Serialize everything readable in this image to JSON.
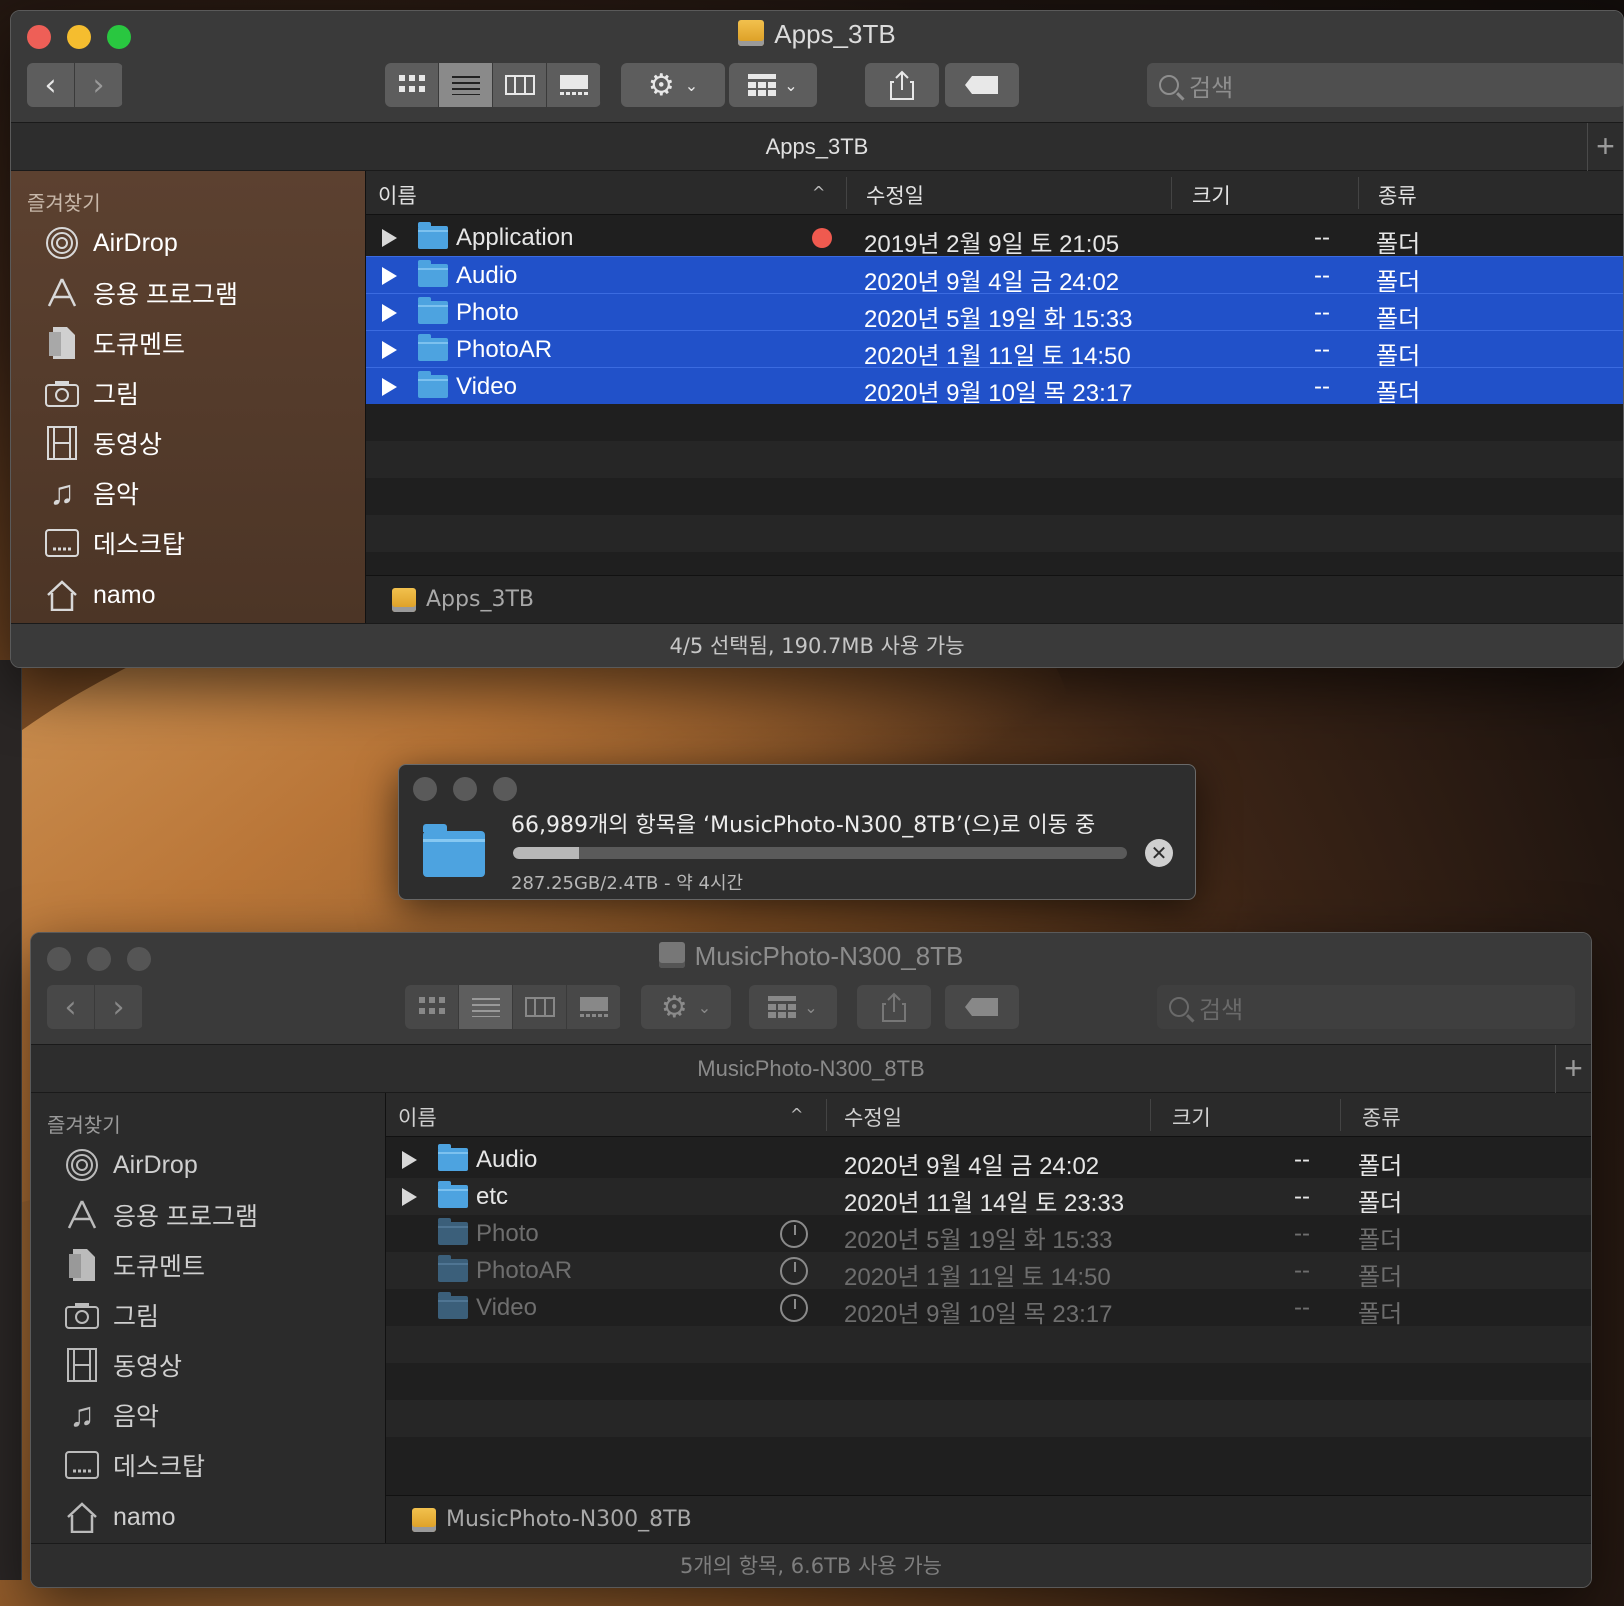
{
  "window1": {
    "title": "Apps_3TB",
    "path_title": "Apps_3TB",
    "search_placeholder": "검색",
    "sidebar_header": "즐겨찾기",
    "sidebar": [
      "AirDrop",
      "응용 프로그램",
      "도큐멘트",
      "그림",
      "동영상",
      "음악",
      "데스크탑",
      "namo"
    ],
    "columns": {
      "name": "이름",
      "date": "수정일",
      "size": "크기",
      "kind": "종류"
    },
    "rows": [
      {
        "name": "Application",
        "date": "2019년 2월 9일 토 21:05",
        "size": "--",
        "kind": "폴더",
        "tag_color": "#ef5a4f"
      },
      {
        "name": "Audio",
        "date": "2020년 9월 4일 금 24:02",
        "size": "--",
        "kind": "폴더",
        "selected": true
      },
      {
        "name": "Photo",
        "date": "2020년 5월 19일 화 15:33",
        "size": "--",
        "kind": "폴더",
        "selected": true
      },
      {
        "name": "PhotoAR",
        "date": "2020년 1월 11일 토 14:50",
        "size": "--",
        "kind": "폴더",
        "selected": true
      },
      {
        "name": "Video",
        "date": "2020년 9월 10일 목 23:17",
        "size": "--",
        "kind": "폴더",
        "selected": true
      }
    ],
    "pathbar": "Apps_3TB",
    "status": "4/5 선택됨, 190.7MB 사용 가능"
  },
  "progress": {
    "message": "66,989개의 항목을 ‘MusicPhoto-N300_8TB’(으)로 이동 중",
    "detail": "287.25GB/2.4TB - 약 4시간",
    "fraction": 0.107
  },
  "window2": {
    "title": "MusicPhoto-N300_8TB",
    "path_title": "MusicPhoto-N300_8TB",
    "search_placeholder": "검색",
    "sidebar_header": "즐겨찾기",
    "sidebar": [
      "AirDrop",
      "응용 프로그램",
      "도큐멘트",
      "그림",
      "동영상",
      "음악",
      "데스크탑",
      "namo"
    ],
    "columns": {
      "name": "이름",
      "date": "수정일",
      "size": "크기",
      "kind": "종류"
    },
    "rows": [
      {
        "name": "Audio",
        "date": "2020년 9월 4일 금 24:02",
        "size": "--",
        "kind": "폴더"
      },
      {
        "name": "etc",
        "date": "2020년 11월 14일 토 23:33",
        "size": "--",
        "kind": "폴더"
      },
      {
        "name": "Photo",
        "date": "2020년 5월 19일 화 15:33",
        "size": "--",
        "kind": "폴더",
        "in_progress": true
      },
      {
        "name": "PhotoAR",
        "date": "2020년 1월 11일 토 14:50",
        "size": "--",
        "kind": "폴더",
        "in_progress": true
      },
      {
        "name": "Video",
        "date": "2020년 9월 10일 목 23:17",
        "size": "--",
        "kind": "폴더",
        "in_progress": true
      }
    ],
    "pathbar": "MusicPhoto-N300_8TB",
    "status": "5개의 항목, 6.6TB 사용 가능"
  },
  "colors": {
    "close": "#ee5f57",
    "minimize": "#f5bd2f",
    "zoom": "#29c740",
    "selection": "#2151c9",
    "folder": "#4da3e0"
  }
}
